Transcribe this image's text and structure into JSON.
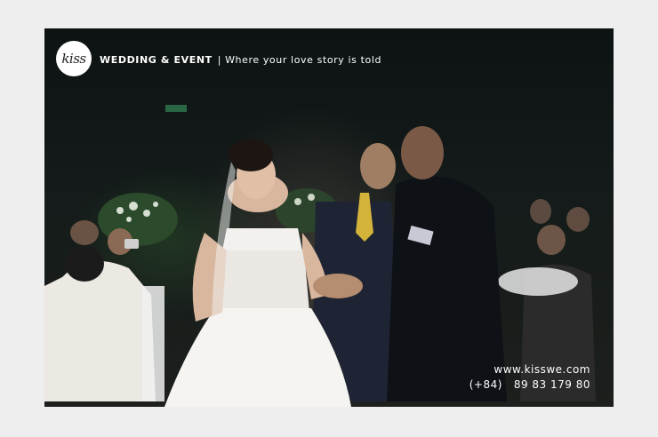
{
  "logo": {
    "text": "kiss"
  },
  "header": {
    "brand": "WEDDING & EVENT",
    "tagline": "Where your love story is told"
  },
  "contact": {
    "website": "www.kisswe.com",
    "phone": "(+84)   89 83 179 80"
  }
}
